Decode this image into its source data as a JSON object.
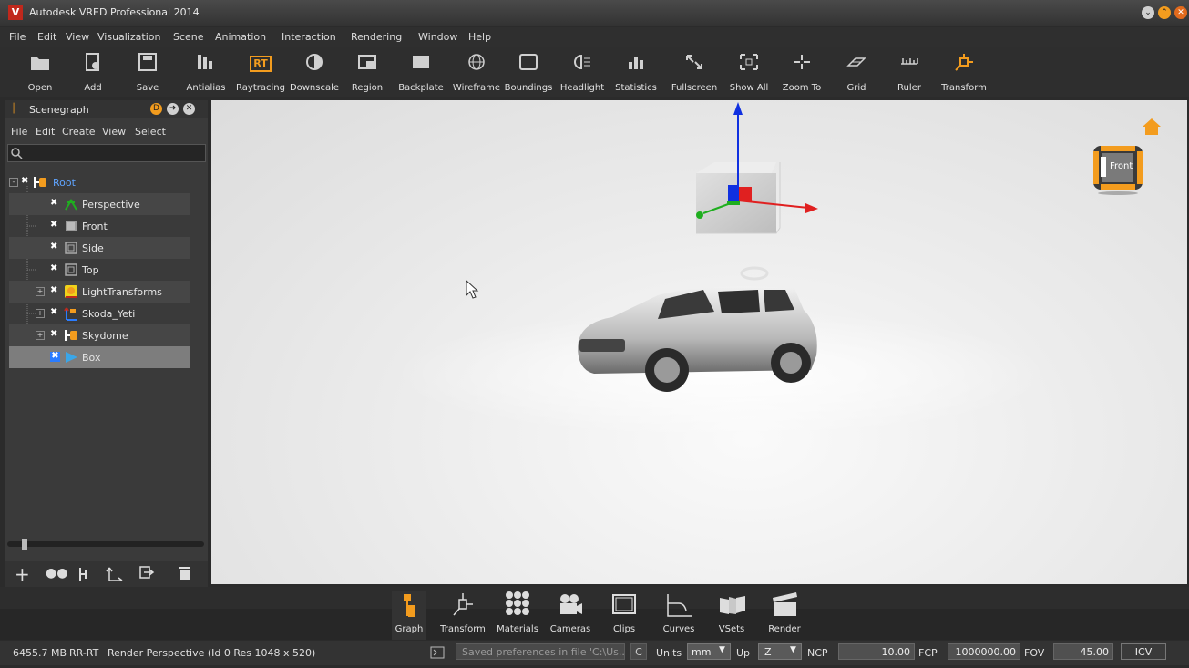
{
  "window": {
    "title": "Autodesk VRED Professional 2014",
    "logo_letter": "V"
  },
  "menubar": [
    "File",
    "Edit",
    "View",
    "Visualization",
    "Scene",
    "Animation",
    "Interaction",
    "Rendering",
    "Window",
    "Help"
  ],
  "toolbar": {
    "tools": [
      "Open",
      "Add",
      "Save",
      "Antialias",
      "Raytracing",
      "Downscale",
      "Region",
      "Backplate",
      "Wireframe",
      "Boundings",
      "Headlight",
      "Statistics",
      "Fullscreen",
      "Show All",
      "Zoom To",
      "Grid",
      "Ruler",
      "Transform"
    ],
    "raytracing_icon_text": "RT"
  },
  "scenegraph": {
    "title": "Scenegraph",
    "menu": [
      "File",
      "Edit",
      "Create",
      "View",
      "Select"
    ],
    "search_placeholder": "",
    "nodes": [
      "Root",
      "Perspective",
      "Front",
      "Side",
      "Top",
      "LightTransforms",
      "Skoda_Yeti",
      "Skydome",
      "Box"
    ],
    "selected": "Box"
  },
  "viewport": {
    "cube_label": "Front"
  },
  "dock": {
    "tabs": [
      "Graph",
      "Transform",
      "Materials",
      "Cameras",
      "Clips",
      "Curves",
      "VSets",
      "Render"
    ],
    "active": "Graph"
  },
  "status": {
    "memory": "6455.7 MB",
    "mode": "RR-RT",
    "info": "Render Perspective (Id 0 Res 1048 x 520)",
    "message": "Saved preferences in file 'C:\\Us...",
    "c_button": "C",
    "units_label": "Units",
    "units_value": "mm",
    "up_label": "Up",
    "up_value": "Z",
    "ncp_label": "NCP",
    "ncp_value": "10.00",
    "fcp_label": "FCP",
    "fcp_value": "1000000.00",
    "fov_label": "FOV",
    "fov_value": "45.00",
    "icv_button": "ICV"
  },
  "colors": {
    "accent": "#f39c1e",
    "selection": "#7d7d7d",
    "axis_x": "#e02020",
    "axis_y": "#1fae1f",
    "axis_z": "#1030e0"
  }
}
